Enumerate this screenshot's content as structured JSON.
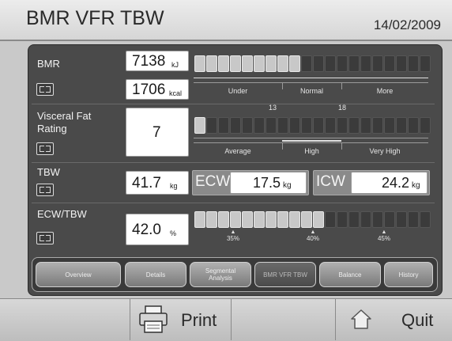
{
  "header": {
    "title": "BMR VFR TBW",
    "date": "14/02/2009"
  },
  "bmr": {
    "label": "BMR",
    "value_kj": "7138",
    "unit_kj": "kJ",
    "value_kcal": "1706",
    "unit_kcal": "kcal",
    "segments_lit": 9,
    "segments_total": 20,
    "zones": [
      "Under",
      "Normal",
      "More"
    ]
  },
  "vfr": {
    "label": "Visceral Fat Rating",
    "value": "7",
    "segments_lit": 1,
    "segments_total": 20,
    "thresholds": [
      "13",
      "18"
    ],
    "zones": [
      "Average",
      "High",
      "Very High"
    ]
  },
  "tbw": {
    "label": "TBW",
    "value": "41.7",
    "unit": "kg",
    "ecw_label": "ECW",
    "ecw_value": "17.5",
    "ecw_unit": "kg",
    "icw_label": "ICW",
    "icw_value": "24.2",
    "icw_unit": "kg"
  },
  "ecw_tbw": {
    "label": "ECW/TBW",
    "value": "42.0",
    "unit": "%",
    "segments_lit": 11,
    "segments_total": 20,
    "markers": [
      "35%",
      "40%",
      "45%"
    ]
  },
  "tabs": [
    {
      "label": "Overview",
      "active": false
    },
    {
      "label": "Details",
      "active": false
    },
    {
      "label": "Segmental Analysis",
      "active": false
    },
    {
      "label": "BMR VFR TBW",
      "active": true
    },
    {
      "label": "Balance",
      "active": false
    },
    {
      "label": "History",
      "active": false
    }
  ],
  "footer": {
    "print_label": "Print",
    "quit_label": "Quit",
    "print_icon": "printer-icon",
    "quit_icon": "home-icon"
  }
}
